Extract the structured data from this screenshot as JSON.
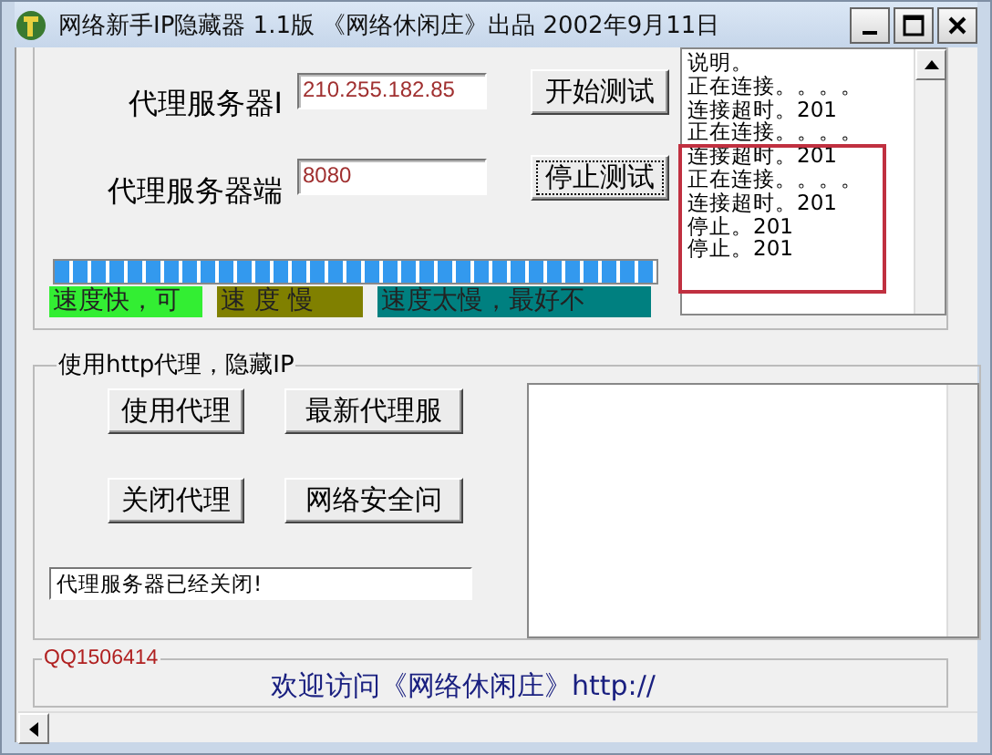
{
  "window": {
    "title": "网络新手IP隐藏器 1.1版 《网络休闲庄》出品 2002年9月11日"
  },
  "proxy_test": {
    "fields": [
      {
        "label": "代理服务器I",
        "value": "210.255.182.85"
      },
      {
        "label": "代理服务器端",
        "value": "8080"
      }
    ],
    "buttons": [
      {
        "label": "开始测试",
        "focused": false
      },
      {
        "label": "停止测试",
        "focused": true
      }
    ],
    "progress": {
      "level": 1
    },
    "speed_labels": [
      {
        "text": "速度快，可",
        "color": "#33ee33"
      },
      {
        "text": "速 度 慢",
        "color": "#808000"
      },
      {
        "text": "速度太慢，最好不",
        "color": "#008080"
      }
    ],
    "log": [
      "说明。",
      "正在连接。。。。",
      "连接超时。201",
      "正在连接。。。。",
      "连接超时。201",
      "正在连接。。。。",
      "连接超时。201",
      "停止。201",
      "停止。201"
    ]
  },
  "proxy_use": {
    "title": "使用http代理，隐藏IP",
    "buttons": [
      "使用代理",
      "最新代理服",
      "关闭代理",
      "网络安全问"
    ],
    "status": "代理服务器已经关闭!"
  },
  "footer": {
    "label": "QQ1506414",
    "text": "欢迎访问《网络休闲庄》http://"
  }
}
